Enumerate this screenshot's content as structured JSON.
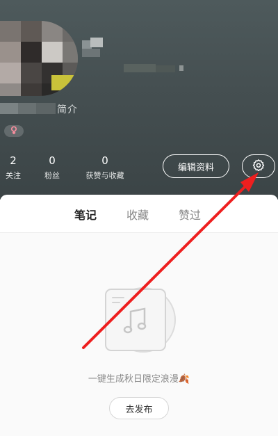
{
  "profile": {
    "bio_text": "简介",
    "gender_icon": "female-symbol-icon"
  },
  "stats": [
    {
      "count": "2",
      "label": "关注"
    },
    {
      "count": "0",
      "label": "粉丝"
    },
    {
      "count": "0",
      "label": "获赞与收藏"
    }
  ],
  "actions": {
    "edit_label": "编辑资料",
    "settings_icon": "gear-icon"
  },
  "tabs": [
    {
      "label": "笔记",
      "active": true
    },
    {
      "label": "收藏",
      "active": false
    },
    {
      "label": "赞过",
      "active": false
    }
  ],
  "empty_state": {
    "icon": "music-record-icon",
    "message": "一键生成秋日限定浪漫",
    "emoji": "🍂",
    "button_label": "去发布"
  },
  "colors": {
    "header_bg": "#454f51",
    "accent_red": "#ff2442",
    "annotation_arrow": "#ee1f1f"
  }
}
